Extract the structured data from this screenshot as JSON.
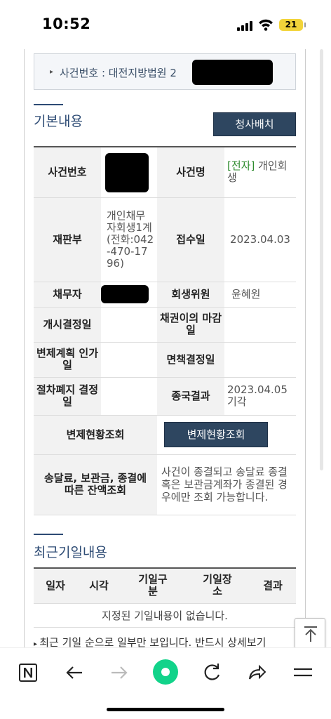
{
  "status": {
    "time": "10:52",
    "battery": "21"
  },
  "case_header": {
    "text": "사건번호 : 대전지방법원 2"
  },
  "basic": {
    "title": "기본내용",
    "assign_button": "청사배치",
    "rows": {
      "case_no_label": "사건번호",
      "case_name_label": "사건명",
      "case_name_tag": "[전자]",
      "case_name_value": " 개인회생",
      "court_label": "재판부",
      "court_value": "개인채무자회생1계 (전화:042-470-1796)",
      "received_label": "접수일",
      "received_value": "2023.04.03",
      "debtor_label": "채무자",
      "committee_label": "회생위원",
      "committee_value": "윤혜원",
      "start_label": "개시결정일",
      "objection_label": "채권이의 마감일",
      "plan_label": "변제계획 인가일",
      "discharge_label": "면책결정일",
      "abolish_label": "절차폐지 결정일",
      "result_label": "종국결과",
      "result_value": "2023.04.05 기각",
      "repay_label": "변제현황조회",
      "repay_button": "변제현황조회",
      "balance_label": "송달료, 보관금, 종결에 따른 잔액조회",
      "balance_value": "사건이 종결되고 송달료 종결 혹은 보관금계좌가 종결된 경우에만 조회 가능합니다."
    }
  },
  "recent": {
    "title": "최근기일내용",
    "headers": [
      "일자",
      "시각",
      "기일구분",
      "기일장소",
      "결과"
    ],
    "empty": "지정된 기일내용이 없습니다.",
    "note": "최근 기일 순으로 일부만 보입니다. 반드시 상세보기"
  },
  "icons": [
    "naver-n-icon",
    "back-icon",
    "forward-icon",
    "green-dot-icon",
    "reload-icon",
    "share-icon",
    "menu-icon",
    "scroll-top-icon"
  ]
}
